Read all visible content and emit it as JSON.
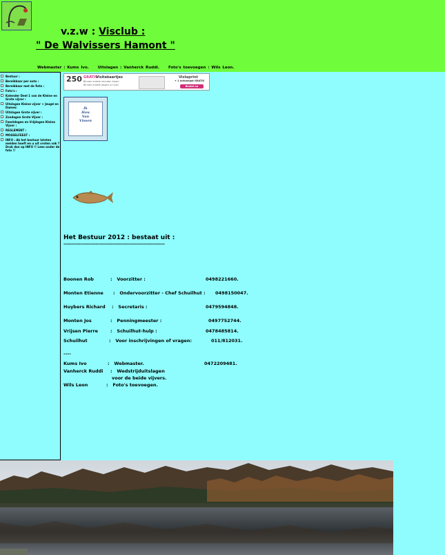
{
  "header": {
    "title_prefix": "v.z.w : ",
    "title_club": "Visclub :",
    "title_name": "\" De Walvissers Hamont \"",
    "credits": [
      "Webmaster :  Kums Ivo.",
      "Uitslagen : Vanherck Ruddi.",
      "Foto's toevoegen : Wils Leon."
    ]
  },
  "sidebar": {
    "items": [
      "Bestuur :",
      "Bereikbaar per auto :",
      "Bereikbaar met de fiets :",
      "Foto's :",
      "Kalender Deel 1 van de Kleine en Grote vijver :",
      "Uitslagen Kleine vijver + Jeugd en Dames:",
      "Uitslagen Grote vijver :",
      "Zondagen Grote Vijver :",
      "Feestdagen en Vrijdagen Kleine Vijver :",
      "REGLEMENT :",
      "MOSSELFEEST :",
      "INFO : Ak het bestuur lotsten melden hoeft en u uit vroten vak ?Druk dan op INFO !! Lees onder de foto !!"
    ]
  },
  "banner": {
    "number": "250",
    "gratis": "GRATIS",
    "product": "Visitekaartjes",
    "line1": "Binnen enkele minuten klaar!",
    "line2": "Binnen enkele dagen in huis!",
    "brand": "Vistaprint",
    "offer": "+ 1 ontvangst GRATIS",
    "button": "Bestel nu"
  },
  "tile": {
    "lines": [
      "Ik",
      "Hou",
      "Van",
      "Vissen"
    ]
  },
  "board": {
    "heading": "Het Bestuur 2012 : bestaat uit :",
    "separator": "-------------------------------------------------------------------",
    "members": [
      {
        "name": "Boonen Rob",
        "role": "Voorzitter :",
        "phone": "0498221660."
      },
      {
        "name": "Monten Etienne",
        "role": "Ondervoorzitter - Chef Schuilhut :",
        "phone": "0498150047."
      },
      {
        "name": "Huybers Richard",
        "role": "Secretaris :",
        "phone": "0479594848."
      },
      {
        "name": "Monten Jos",
        "role": "Penningmeester :",
        "phone": "0497752744."
      },
      {
        "name": "Vrijsen Pierre",
        "role": "Schuilhut-hulp :",
        "phone": "0478485814."
      },
      {
        "name": "Schuilhut",
        "role": "Voor inschrijvingen of vragen:",
        "phone": "011/812031."
      }
    ],
    "short_dash": "----",
    "extra": [
      {
        "name": "Kums Ivo",
        "role": "Webmaster.",
        "phone": "0472209481."
      },
      {
        "name": "Vanherck Ruddi",
        "role": "Wedstrijduitslagen",
        "phone": ""
      },
      {
        "name": "",
        "role": "voor de beide vijvers.",
        "phone": ""
      },
      {
        "name": "Wils Leon",
        "role": "Foto's toevoegen.",
        "phone": ""
      }
    ]
  }
}
